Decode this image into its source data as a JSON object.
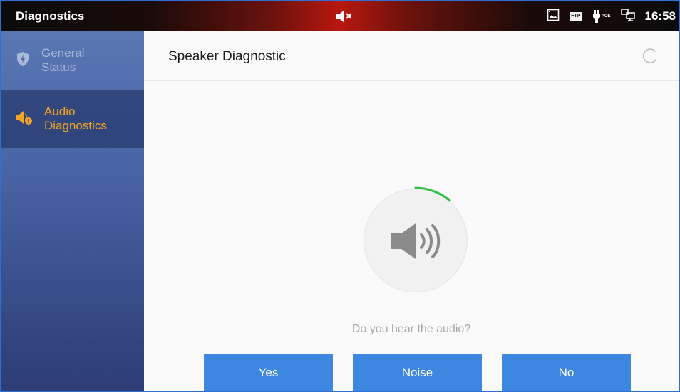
{
  "status_bar": {
    "app_title": "Diagnostics",
    "ftp_label": "FTP",
    "poe_label": "POE",
    "time": "16:58",
    "icons": [
      "volume-muted-icon",
      "screenshot-icon",
      "ftp-icon",
      "poe-icon",
      "network-icon"
    ]
  },
  "sidebar": {
    "items": [
      {
        "label_line1": "General",
        "label_line2": "Status",
        "icon": "shield-icon",
        "selected": false
      },
      {
        "label_line1": "Audio",
        "label_line2": "Diagnostics",
        "icon": "speaker-alert-icon",
        "selected": true
      }
    ]
  },
  "main": {
    "title": "Speaker Diagnostic",
    "prompt": "Do you hear the audio?",
    "buttons": {
      "yes": "Yes",
      "noise": "Noise",
      "no": "No"
    }
  },
  "colors": {
    "accent_blue": "#3e87e0",
    "selected_text": "#f5a524",
    "progress_green": "#2fbf4a"
  }
}
